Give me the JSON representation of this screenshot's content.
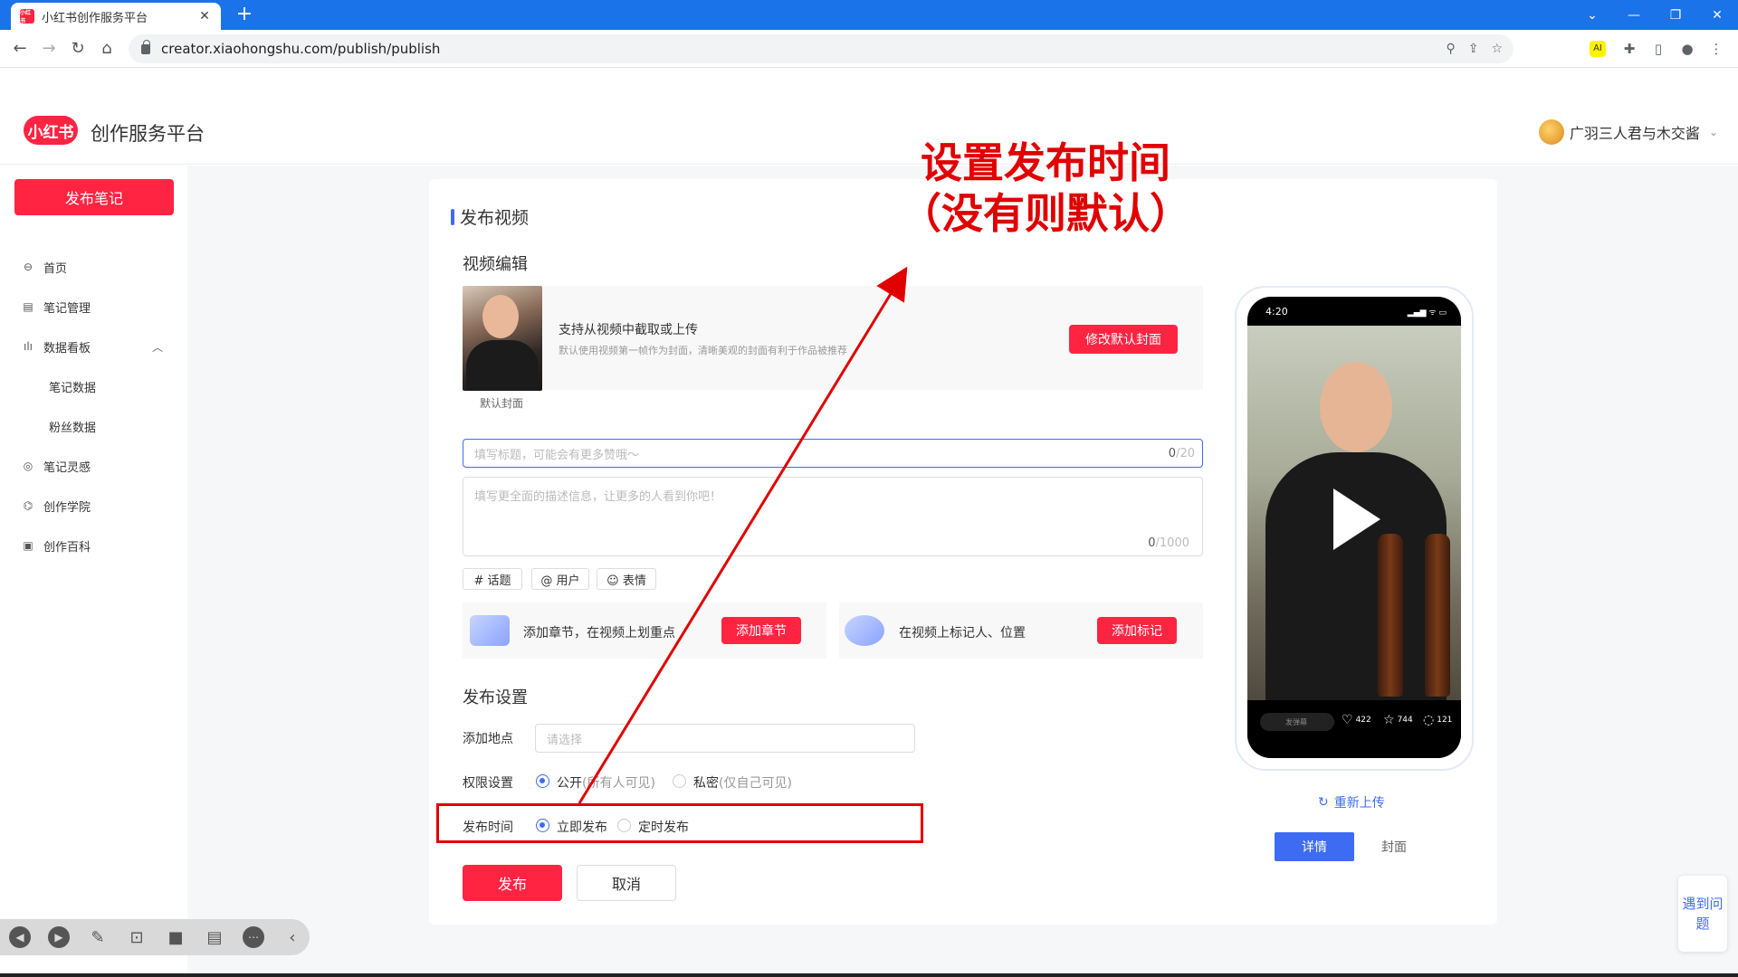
{
  "browser": {
    "tab_title": "小红书创作服务平台",
    "tab_close": "✕",
    "new_tab": "+",
    "url": "creator.xiaohongshu.com/publish/publish",
    "favicon_text": "小红书",
    "controls": {
      "dropdown": "⌄",
      "minimize": "—",
      "restore": "❐",
      "close": "✕"
    }
  },
  "header": {
    "logo_text": "小红书",
    "platform_title": "创作服务平台",
    "username": "广羽三人君与木交酱"
  },
  "sidebar": {
    "publish_button": "发布笔记",
    "items": [
      {
        "label": "首页",
        "icon": "home-icon"
      },
      {
        "label": "笔记管理",
        "icon": "note-icon"
      },
      {
        "label": "数据看板",
        "icon": "chart-icon"
      },
      {
        "label": "笔记灵感",
        "icon": "bulb-icon"
      },
      {
        "label": "创作学院",
        "icon": "academy-icon"
      },
      {
        "label": "创作百科",
        "icon": "book-icon"
      }
    ],
    "sub_items": [
      "笔记数据",
      "粉丝数据"
    ]
  },
  "main": {
    "section_title": "发布视频",
    "video_edit": {
      "title": "视频编辑",
      "cover_label": "默认封面",
      "cover_tip_main": "支持从视频中截取或上传",
      "cover_tip_sub": "默认使用视频第一帧作为封面，清晰美观的封面有利于作品被推荐",
      "modify_cover_button": "修改默认封面",
      "title_placeholder": "填写标题，可能会有更多赞哦～",
      "title_count_current": "0",
      "title_count_max": "/20",
      "desc_placeholder": "填写更全面的描述信息，让更多的人看到你吧！",
      "desc_count_current": "0",
      "desc_count_max": "/1000",
      "tags": [
        "# 话题",
        "@ 用户",
        "☺ 表情"
      ],
      "chapter_text": "添加章节，在视频上划重点",
      "chapter_button": "添加章节",
      "mark_text": "在视频上标记人、位置",
      "mark_button": "添加标记"
    },
    "publish_settings": {
      "title": "发布设置",
      "location_label": "添加地点",
      "location_placeholder": "请选择",
      "permission_label": "权限设置",
      "permission_public": "公开",
      "permission_public_note": "(所有人可见)",
      "permission_private": "私密",
      "permission_private_note": "(仅自己可见)",
      "time_label": "发布时间",
      "time_now": "立即发布",
      "time_scheduled": "定时发布"
    },
    "publish_button": "发布",
    "cancel_button": "取消"
  },
  "preview": {
    "time": "4:20",
    "status": "▂▄▆ ᯤ ▭",
    "comment_placeholder": "发弹幕",
    "likes": "422",
    "stars": "744",
    "comments": "121",
    "reupload": "重新上传",
    "tab_detail": "详情",
    "tab_cover": "封面"
  },
  "help": "遇到问题",
  "annotation": {
    "line1": "设置发布时间",
    "line2": "（没有则默认）",
    "color": "#e00000"
  }
}
